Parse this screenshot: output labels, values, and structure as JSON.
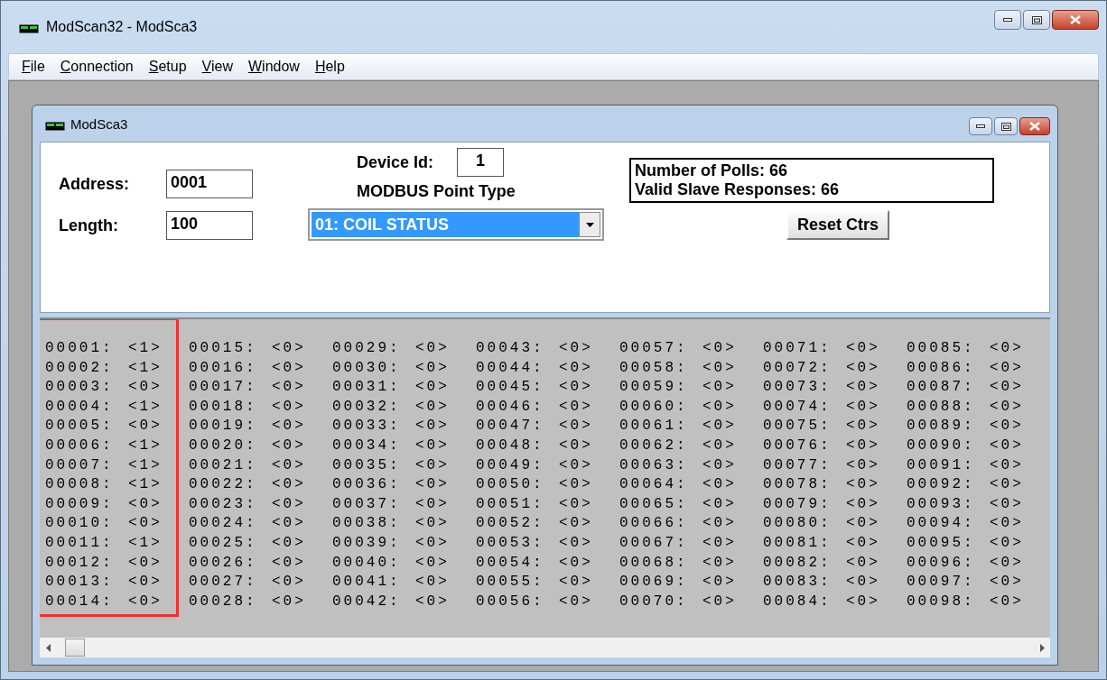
{
  "window": {
    "title": "ModScan32 - ModSca3"
  },
  "menu": [
    {
      "label": "File"
    },
    {
      "label": "Connection"
    },
    {
      "label": "Setup"
    },
    {
      "label": "View"
    },
    {
      "label": "Window"
    },
    {
      "label": "Help"
    }
  ],
  "child_window": {
    "title": "ModSca3",
    "address_label": "Address:",
    "address": "0001",
    "length_label": "Length:",
    "length": "100",
    "device_id_label": "Device Id:",
    "device_id": "1",
    "point_type_label": "MODBUS Point Type",
    "point_type": "01: COIL STATUS",
    "stats": [
      "Number of Polls: 66",
      "Valid Slave Responses: 66"
    ],
    "reset_button": "Reset Ctrs",
    "columns": [
      {
        "highlighted": true,
        "cells": [
          {
            "address": "00001:",
            "value": "<1>"
          },
          {
            "address": "00002:",
            "value": "<1>"
          },
          {
            "address": "00003:",
            "value": "<0>"
          },
          {
            "address": "00004:",
            "value": "<1>"
          },
          {
            "address": "00005:",
            "value": "<0>"
          },
          {
            "address": "00006:",
            "value": "<1>"
          },
          {
            "address": "00007:",
            "value": "<1>"
          },
          {
            "address": "00008:",
            "value": "<1>"
          },
          {
            "address": "00009:",
            "value": "<0>"
          },
          {
            "address": "00010:",
            "value": "<0>"
          },
          {
            "address": "00011:",
            "value": "<1>"
          },
          {
            "address": "00012:",
            "value": "<0>"
          },
          {
            "address": "00013:",
            "value": "<0>"
          },
          {
            "address": "00014:",
            "value": "<0>"
          }
        ]
      },
      {
        "highlighted": false,
        "cells": [
          {
            "address": "00015:",
            "value": "<0>"
          },
          {
            "address": "00016:",
            "value": "<0>"
          },
          {
            "address": "00017:",
            "value": "<0>"
          },
          {
            "address": "00018:",
            "value": "<0>"
          },
          {
            "address": "00019:",
            "value": "<0>"
          },
          {
            "address": "00020:",
            "value": "<0>"
          },
          {
            "address": "00021:",
            "value": "<0>"
          },
          {
            "address": "00022:",
            "value": "<0>"
          },
          {
            "address": "00023:",
            "value": "<0>"
          },
          {
            "address": "00024:",
            "value": "<0>"
          },
          {
            "address": "00025:",
            "value": "<0>"
          },
          {
            "address": "00026:",
            "value": "<0>"
          },
          {
            "address": "00027:",
            "value": "<0>"
          },
          {
            "address": "00028:",
            "value": "<0>"
          }
        ]
      },
      {
        "highlighted": false,
        "cells": [
          {
            "address": "00029:",
            "value": "<0>"
          },
          {
            "address": "00030:",
            "value": "<0>"
          },
          {
            "address": "00031:",
            "value": "<0>"
          },
          {
            "address": "00032:",
            "value": "<0>"
          },
          {
            "address": "00033:",
            "value": "<0>"
          },
          {
            "address": "00034:",
            "value": "<0>"
          },
          {
            "address": "00035:",
            "value": "<0>"
          },
          {
            "address": "00036:",
            "value": "<0>"
          },
          {
            "address": "00037:",
            "value": "<0>"
          },
          {
            "address": "00038:",
            "value": "<0>"
          },
          {
            "address": "00039:",
            "value": "<0>"
          },
          {
            "address": "00040:",
            "value": "<0>"
          },
          {
            "address": "00041:",
            "value": "<0>"
          },
          {
            "address": "00042:",
            "value": "<0>"
          }
        ]
      },
      {
        "highlighted": false,
        "cells": [
          {
            "address": "00043:",
            "value": "<0>"
          },
          {
            "address": "00044:",
            "value": "<0>"
          },
          {
            "address": "00045:",
            "value": "<0>"
          },
          {
            "address": "00046:",
            "value": "<0>"
          },
          {
            "address": "00047:",
            "value": "<0>"
          },
          {
            "address": "00048:",
            "value": "<0>"
          },
          {
            "address": "00049:",
            "value": "<0>"
          },
          {
            "address": "00050:",
            "value": "<0>"
          },
          {
            "address": "00051:",
            "value": "<0>"
          },
          {
            "address": "00052:",
            "value": "<0>"
          },
          {
            "address": "00053:",
            "value": "<0>"
          },
          {
            "address": "00054:",
            "value": "<0>"
          },
          {
            "address": "00055:",
            "value": "<0>"
          },
          {
            "address": "00056:",
            "value": "<0>"
          }
        ]
      },
      {
        "highlighted": false,
        "cells": [
          {
            "address": "00057:",
            "value": "<0>"
          },
          {
            "address": "00058:",
            "value": "<0>"
          },
          {
            "address": "00059:",
            "value": "<0>"
          },
          {
            "address": "00060:",
            "value": "<0>"
          },
          {
            "address": "00061:",
            "value": "<0>"
          },
          {
            "address": "00062:",
            "value": "<0>"
          },
          {
            "address": "00063:",
            "value": "<0>"
          },
          {
            "address": "00064:",
            "value": "<0>"
          },
          {
            "address": "00065:",
            "value": "<0>"
          },
          {
            "address": "00066:",
            "value": "<0>"
          },
          {
            "address": "00067:",
            "value": "<0>"
          },
          {
            "address": "00068:",
            "value": "<0>"
          },
          {
            "address": "00069:",
            "value": "<0>"
          },
          {
            "address": "00070:",
            "value": "<0>"
          }
        ]
      },
      {
        "highlighted": false,
        "cells": [
          {
            "address": "00071:",
            "value": "<0>"
          },
          {
            "address": "00072:",
            "value": "<0>"
          },
          {
            "address": "00073:",
            "value": "<0>"
          },
          {
            "address": "00074:",
            "value": "<0>"
          },
          {
            "address": "00075:",
            "value": "<0>"
          },
          {
            "address": "00076:",
            "value": "<0>"
          },
          {
            "address": "00077:",
            "value": "<0>"
          },
          {
            "address": "00078:",
            "value": "<0>"
          },
          {
            "address": "00079:",
            "value": "<0>"
          },
          {
            "address": "00080:",
            "value": "<0>"
          },
          {
            "address": "00081:",
            "value": "<0>"
          },
          {
            "address": "00082:",
            "value": "<0>"
          },
          {
            "address": "00083:",
            "value": "<0>"
          },
          {
            "address": "00084:",
            "value": "<0>"
          }
        ]
      },
      {
        "highlighted": false,
        "cells": [
          {
            "address": "00085:",
            "value": "<0>"
          },
          {
            "address": "00086:",
            "value": "<0>"
          },
          {
            "address": "00087:",
            "value": "<0>"
          },
          {
            "address": "00088:",
            "value": "<0>"
          },
          {
            "address": "00089:",
            "value": "<0>"
          },
          {
            "address": "00090:",
            "value": "<0>"
          },
          {
            "address": "00091:",
            "value": "<0>"
          },
          {
            "address": "00092:",
            "value": "<0>"
          },
          {
            "address": "00093:",
            "value": "<0>"
          },
          {
            "address": "00094:",
            "value": "<0>"
          },
          {
            "address": "00095:",
            "value": "<0>"
          },
          {
            "address": "00096:",
            "value": "<0>"
          },
          {
            "address": "00097:",
            "value": "<0>"
          },
          {
            "address": "00098:",
            "value": "<0>"
          }
        ]
      }
    ]
  }
}
